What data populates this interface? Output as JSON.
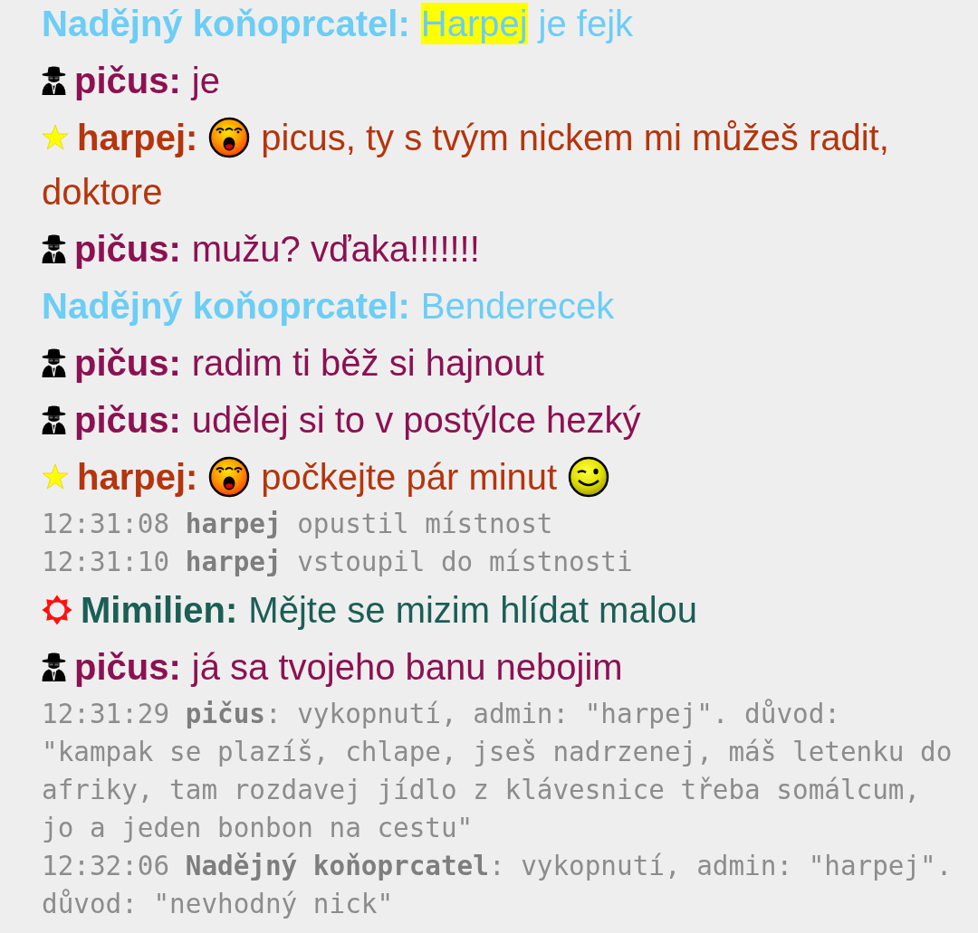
{
  "messages": [
    {
      "kind": "chat",
      "name": "Nadějný koňoprcatel:",
      "color": "#6ccdf5",
      "parts": [
        {
          "kind": "mention",
          "text": "Harpej"
        },
        {
          "kind": "text",
          "text": "je fejk"
        }
      ]
    },
    {
      "kind": "chat",
      "badge": {
        "kind": "spy"
      },
      "name": "pičus:",
      "color": "#8c1152",
      "parts": [
        {
          "kind": "text",
          "text": "je"
        }
      ]
    },
    {
      "kind": "chat",
      "badge": {
        "kind": "star"
      },
      "name": "harpej:",
      "color": "#b5350d",
      "parts": [
        {
          "kind": "yell"
        },
        {
          "kind": "text",
          "text": "picus, ty s tvým nickem mi můžeš radit,"
        },
        {
          "kind": "text",
          "text": "doktore"
        }
      ]
    },
    {
      "kind": "chat",
      "badge": {
        "kind": "spy"
      },
      "name": "pičus:",
      "color": "#8c1152",
      "parts": [
        {
          "kind": "text",
          "text": "mužu? vďaka!!!!!!!"
        }
      ]
    },
    {
      "kind": "chat",
      "name": "Nadějný koňoprcatel:",
      "color": "#6ccdf5",
      "parts": [
        {
          "kind": "text",
          "text": "Benderecek"
        }
      ]
    },
    {
      "kind": "chat",
      "badge": {
        "kind": "spy"
      },
      "name": "pičus:",
      "color": "#8c1152",
      "parts": [
        {
          "kind": "text",
          "text": "radim ti běž si hajnout"
        }
      ]
    },
    {
      "kind": "chat",
      "badge": {
        "kind": "spy"
      },
      "name": "pičus:",
      "color": "#8c1152",
      "parts": [
        {
          "kind": "text",
          "text": "udělej si to v postýlce hezký"
        }
      ]
    },
    {
      "kind": "chat",
      "badge": {
        "kind": "star"
      },
      "name": "harpej:",
      "color": "#b5350d",
      "parts": [
        {
          "kind": "yell"
        },
        {
          "kind": "text",
          "text": "počkejte pár minut"
        },
        {
          "kind": "wink"
        }
      ]
    },
    {
      "kind": "system",
      "text": "12:31:08 **harpej** opustil místnost"
    },
    {
      "kind": "system",
      "text": "12:31:10 **harpej** vstoupil do místnosti"
    },
    {
      "kind": "chat",
      "badge": {
        "kind": "sun"
      },
      "name": "Mimilien:",
      "color": "#1b5e55",
      "parts": [
        {
          "kind": "text",
          "text": "Mějte se mizim hlídat malou"
        }
      ]
    },
    {
      "kind": "chat",
      "badge": {
        "kind": "spy"
      },
      "name": "pičus:",
      "color": "#8c1152",
      "parts": [
        {
          "kind": "text",
          "text": "já sa tvojeho banu nebojim"
        }
      ]
    },
    {
      "kind": "system",
      "text": "12:31:29 **pičus**: vykopnutí, admin: \"harpej\". důvod: \"kampak se plazíš, chlape, jseš nadrzenej, máš letenku do afriky, tam rozdavej jídlo z klávesnice třeba somálcum, jo a jeden bonbon na cestu\""
    },
    {
      "kind": "system",
      "text": "12:32:06 **Nadějný koňoprcatel**: vykopnutí, admin: \"harpej\". důvod: \"nevhodný nick\""
    }
  ]
}
